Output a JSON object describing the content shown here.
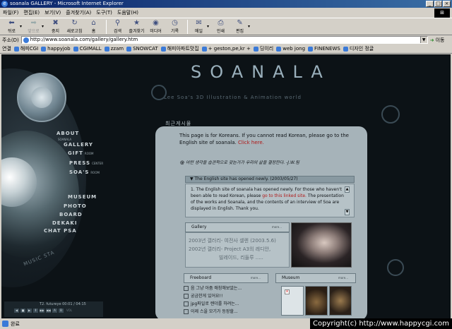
{
  "window": {
    "title": "soanala GALLERY - Microsoft Internet Explorer",
    "min": "_",
    "max": "□",
    "close": "×"
  },
  "menu": [
    "파일(F)",
    "편집(E)",
    "보기(V)",
    "즐겨찾기(A)",
    "도구(T)",
    "도움말(H)"
  ],
  "toolbar": {
    "back": "뒤로",
    "forward": "앞으로",
    "stop": "중지",
    "refresh": "새로고침",
    "home": "홈",
    "search": "검색",
    "favorites": "즐겨찾기",
    "media": "미디어",
    "history": "기록",
    "mail": "메일",
    "print": "인쇄",
    "edit": "편집"
  },
  "address": {
    "label": "주소(D)",
    "url": "http://www.soanala.com/gallery/gallery.htm",
    "go": "이동",
    "links_label": "연결"
  },
  "links": [
    "해피CGI",
    "happyjob",
    "CGIMALL",
    "zzam",
    "SNOWCAT",
    "해피아파트맛집",
    "+ geston,pe,kr +",
    "딩이리",
    "web jong",
    "FINENEWS",
    "디자인 정글"
  ],
  "status": {
    "text": "완료",
    "copyright": "Copyright(c) http://www.happycgi.com"
  },
  "site": {
    "logo": "SOANALA",
    "tagline": "Lee Soa's 3D Illustration & Animation world",
    "nav": [
      {
        "label": "ABOUT",
        "sub": "SOANALA"
      },
      {
        "label": "GALLERY",
        "sub": ""
      },
      {
        "label": "GIFT",
        "sub": "ROOM"
      },
      {
        "label": "PRESS",
        "sub": "CENTER"
      },
      {
        "label": "SOA'S",
        "sub": "ROOM"
      },
      {
        "label": "MUSEUM",
        "sub": ""
      },
      {
        "label": "PHOTO",
        "sub": ""
      },
      {
        "label": "BOARD",
        "sub": ""
      },
      {
        "label": "DEKAKI",
        "sub": ""
      },
      {
        "label": "CHAT",
        "sub": "PSA"
      }
    ],
    "music_status": "MUSIC STA",
    "player": {
      "track": "T2. futureye 00:01 / 04:15",
      "buttons": [
        "◀",
        "■",
        "▶",
        "Ⅱ",
        "▶▶",
        "◀◀",
        "A",
        "B"
      ],
      "vol": "VOL"
    },
    "panel_title": "최근게시물",
    "intro": {
      "text": "This page is for Koreans. If you cannot read Korean, please go to the English site of soanala. ",
      "link": "Click here."
    },
    "quote": "어떤 생각을 습관적으로 갖는가가 우리의 삶을 결정한다. -J.W.팀",
    "news": {
      "header": "▼ The English site has opened newly.  (2003/05/27)",
      "body_pre": "1. The English site of soanala has opened newly. For those who haven't been able to read Korean, please ",
      "body_link": "go to this linked site.",
      "body_post": " The presentation of the works and Soanala, and the contents of an interview of Soa are displayed in English. Thank you."
    },
    "gallery": {
      "title": "Gallery",
      "more": "more...",
      "line1": "2003년 갤러리- 여전사 셀렌 (2003.5.6)",
      "line2": "2002년 갤러리- Project A3의 레디안,",
      "line3": "빌레이드, 리들루 ....."
    },
    "freeboard": {
      "title": "Freeboard",
      "more": "more...",
      "items": [
        "음 그냥 아줌 애칭해보았는...",
        "궁금한게 있어요!!",
        "jpg파일로 렌더를 하려는...",
        "이제 스을 모기가 등장할..."
      ]
    },
    "museum": {
      "title": "Museum",
      "more": "more..."
    }
  }
}
